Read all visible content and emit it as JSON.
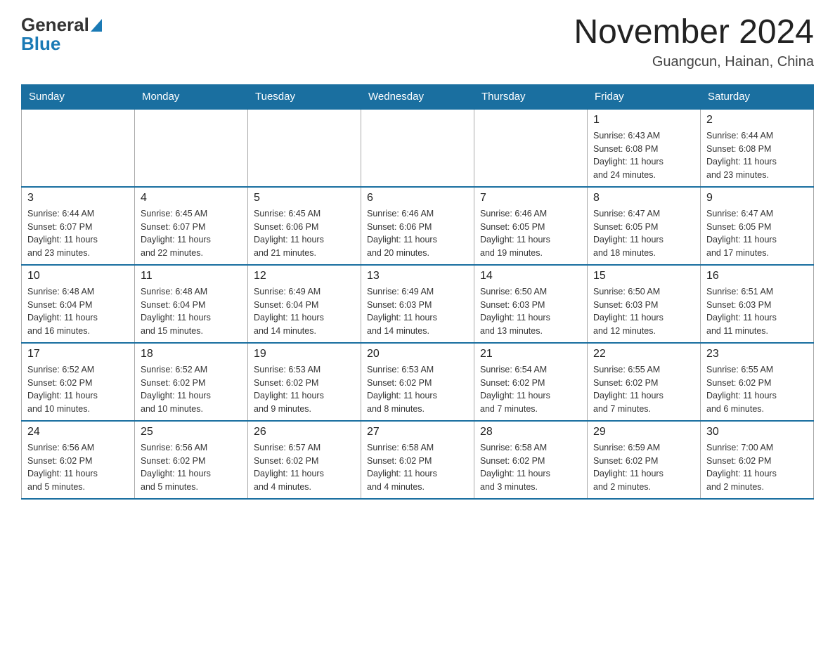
{
  "header": {
    "logo_general": "General",
    "logo_blue": "Blue",
    "month_title": "November 2024",
    "subtitle": "Guangcun, Hainan, China"
  },
  "weekdays": [
    "Sunday",
    "Monday",
    "Tuesday",
    "Wednesday",
    "Thursday",
    "Friday",
    "Saturday"
  ],
  "weeks": [
    [
      {
        "day": "",
        "info": ""
      },
      {
        "day": "",
        "info": ""
      },
      {
        "day": "",
        "info": ""
      },
      {
        "day": "",
        "info": ""
      },
      {
        "day": "",
        "info": ""
      },
      {
        "day": "1",
        "info": "Sunrise: 6:43 AM\nSunset: 6:08 PM\nDaylight: 11 hours\nand 24 minutes."
      },
      {
        "day": "2",
        "info": "Sunrise: 6:44 AM\nSunset: 6:08 PM\nDaylight: 11 hours\nand 23 minutes."
      }
    ],
    [
      {
        "day": "3",
        "info": "Sunrise: 6:44 AM\nSunset: 6:07 PM\nDaylight: 11 hours\nand 23 minutes."
      },
      {
        "day": "4",
        "info": "Sunrise: 6:45 AM\nSunset: 6:07 PM\nDaylight: 11 hours\nand 22 minutes."
      },
      {
        "day": "5",
        "info": "Sunrise: 6:45 AM\nSunset: 6:06 PM\nDaylight: 11 hours\nand 21 minutes."
      },
      {
        "day": "6",
        "info": "Sunrise: 6:46 AM\nSunset: 6:06 PM\nDaylight: 11 hours\nand 20 minutes."
      },
      {
        "day": "7",
        "info": "Sunrise: 6:46 AM\nSunset: 6:05 PM\nDaylight: 11 hours\nand 19 minutes."
      },
      {
        "day": "8",
        "info": "Sunrise: 6:47 AM\nSunset: 6:05 PM\nDaylight: 11 hours\nand 18 minutes."
      },
      {
        "day": "9",
        "info": "Sunrise: 6:47 AM\nSunset: 6:05 PM\nDaylight: 11 hours\nand 17 minutes."
      }
    ],
    [
      {
        "day": "10",
        "info": "Sunrise: 6:48 AM\nSunset: 6:04 PM\nDaylight: 11 hours\nand 16 minutes."
      },
      {
        "day": "11",
        "info": "Sunrise: 6:48 AM\nSunset: 6:04 PM\nDaylight: 11 hours\nand 15 minutes."
      },
      {
        "day": "12",
        "info": "Sunrise: 6:49 AM\nSunset: 6:04 PM\nDaylight: 11 hours\nand 14 minutes."
      },
      {
        "day": "13",
        "info": "Sunrise: 6:49 AM\nSunset: 6:03 PM\nDaylight: 11 hours\nand 14 minutes."
      },
      {
        "day": "14",
        "info": "Sunrise: 6:50 AM\nSunset: 6:03 PM\nDaylight: 11 hours\nand 13 minutes."
      },
      {
        "day": "15",
        "info": "Sunrise: 6:50 AM\nSunset: 6:03 PM\nDaylight: 11 hours\nand 12 minutes."
      },
      {
        "day": "16",
        "info": "Sunrise: 6:51 AM\nSunset: 6:03 PM\nDaylight: 11 hours\nand 11 minutes."
      }
    ],
    [
      {
        "day": "17",
        "info": "Sunrise: 6:52 AM\nSunset: 6:02 PM\nDaylight: 11 hours\nand 10 minutes."
      },
      {
        "day": "18",
        "info": "Sunrise: 6:52 AM\nSunset: 6:02 PM\nDaylight: 11 hours\nand 10 minutes."
      },
      {
        "day": "19",
        "info": "Sunrise: 6:53 AM\nSunset: 6:02 PM\nDaylight: 11 hours\nand 9 minutes."
      },
      {
        "day": "20",
        "info": "Sunrise: 6:53 AM\nSunset: 6:02 PM\nDaylight: 11 hours\nand 8 minutes."
      },
      {
        "day": "21",
        "info": "Sunrise: 6:54 AM\nSunset: 6:02 PM\nDaylight: 11 hours\nand 7 minutes."
      },
      {
        "day": "22",
        "info": "Sunrise: 6:55 AM\nSunset: 6:02 PM\nDaylight: 11 hours\nand 7 minutes."
      },
      {
        "day": "23",
        "info": "Sunrise: 6:55 AM\nSunset: 6:02 PM\nDaylight: 11 hours\nand 6 minutes."
      }
    ],
    [
      {
        "day": "24",
        "info": "Sunrise: 6:56 AM\nSunset: 6:02 PM\nDaylight: 11 hours\nand 5 minutes."
      },
      {
        "day": "25",
        "info": "Sunrise: 6:56 AM\nSunset: 6:02 PM\nDaylight: 11 hours\nand 5 minutes."
      },
      {
        "day": "26",
        "info": "Sunrise: 6:57 AM\nSunset: 6:02 PM\nDaylight: 11 hours\nand 4 minutes."
      },
      {
        "day": "27",
        "info": "Sunrise: 6:58 AM\nSunset: 6:02 PM\nDaylight: 11 hours\nand 4 minutes."
      },
      {
        "day": "28",
        "info": "Sunrise: 6:58 AM\nSunset: 6:02 PM\nDaylight: 11 hours\nand 3 minutes."
      },
      {
        "day": "29",
        "info": "Sunrise: 6:59 AM\nSunset: 6:02 PM\nDaylight: 11 hours\nand 2 minutes."
      },
      {
        "day": "30",
        "info": "Sunrise: 7:00 AM\nSunset: 6:02 PM\nDaylight: 11 hours\nand 2 minutes."
      }
    ]
  ]
}
